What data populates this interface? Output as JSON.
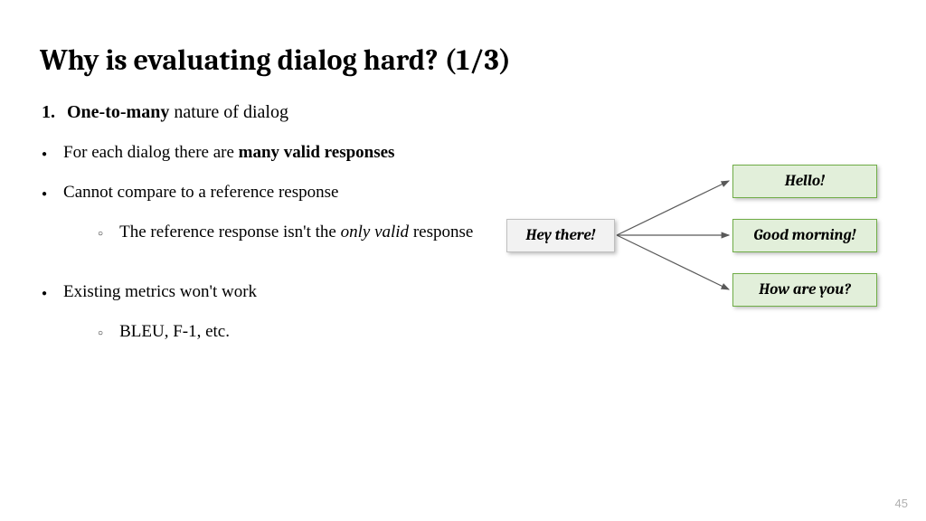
{
  "title": "Why is evaluating dialog hard? (1/3)",
  "ol": {
    "num": "1.",
    "bold": "One-to-many",
    "rest": " nature of dialog"
  },
  "bullets": {
    "b1_pre": "For each dialog there are ",
    "b1_bold": "many valid responses",
    "b2": "Cannot compare to a reference response",
    "b2_sub_pre": "The reference response isn't the ",
    "b2_sub_italic": "only valid",
    "b2_sub_post": " response",
    "b3": "Existing metrics won't work",
    "b3_sub": "BLEU, F-1, etc."
  },
  "diagram": {
    "source": "Hey there!",
    "dst1": "Hello!",
    "dst2": "Good morning!",
    "dst3": "How are you?",
    "src_bg": "#f2f2f2",
    "src_border": "#bfbfbf",
    "dst_bg": "#e2efda",
    "dst_border": "#70ad47",
    "arrow_color": "#595959"
  },
  "page_number": "45"
}
